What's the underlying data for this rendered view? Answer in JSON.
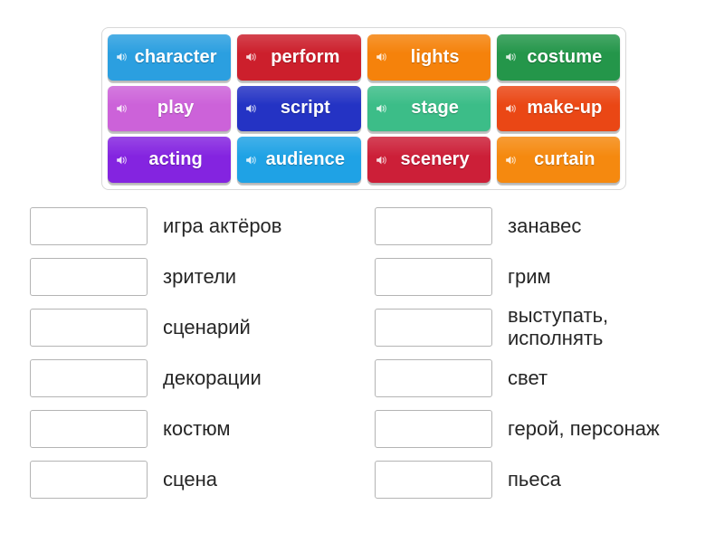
{
  "tiles": [
    {
      "label": "character",
      "color": "#2b9fe0",
      "icon": "speaker-icon"
    },
    {
      "label": "perform",
      "color": "#cc1f2c",
      "icon": "speaker-icon"
    },
    {
      "label": "lights",
      "color": "#f5820b",
      "icon": "speaker-icon"
    },
    {
      "label": "costume",
      "color": "#24964a",
      "icon": "speaker-icon"
    },
    {
      "label": "play",
      "color": "#cc62d9",
      "icon": "speaker-icon"
    },
    {
      "label": "script",
      "color": "#2433c4",
      "icon": "speaker-icon"
    },
    {
      "label": "stage",
      "color": "#3cbd88",
      "icon": "speaker-icon"
    },
    {
      "label": "make-up",
      "color": "#ea4715",
      "icon": "speaker-icon"
    },
    {
      "label": "acting",
      "color": "#8424e0",
      "icon": "speaker-icon"
    },
    {
      "label": "audience",
      "color": "#1fa2e5",
      "icon": "speaker-icon"
    },
    {
      "label": "scenery",
      "color": "#cc1f38",
      "icon": "speaker-icon"
    },
    {
      "label": "curtain",
      "color": "#f5890f",
      "icon": "speaker-icon"
    }
  ],
  "answers": {
    "left": [
      {
        "box_value": "",
        "text": "игра актёров"
      },
      {
        "box_value": "",
        "text": "зрители"
      },
      {
        "box_value": "",
        "text": "сценарий"
      },
      {
        "box_value": "",
        "text": "декорации"
      },
      {
        "box_value": "",
        "text": "костюм"
      },
      {
        "box_value": "",
        "text": "сцена"
      }
    ],
    "right": [
      {
        "box_value": "",
        "text": "занавес"
      },
      {
        "box_value": "",
        "text": "грим"
      },
      {
        "box_value": "",
        "text": "выступать,\nисполнять"
      },
      {
        "box_value": "",
        "text": "свет"
      },
      {
        "box_value": "",
        "text": "герой, персонаж"
      },
      {
        "box_value": "",
        "text": "пьеса"
      }
    ]
  },
  "colors": {
    "page_background": "#ffffff",
    "panel_border": "#d8d8d8",
    "box_border": "#b4b4b4",
    "text": "#262626",
    "tile_text": "#ffffff"
  }
}
